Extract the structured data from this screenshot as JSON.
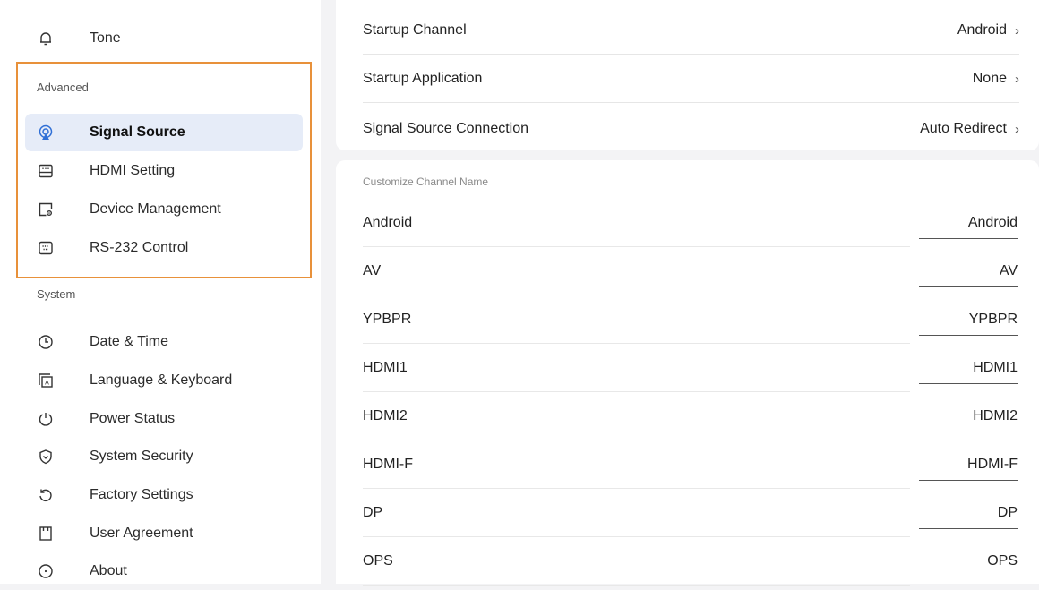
{
  "sidebar": {
    "top_item": {
      "label": "Tone",
      "icon": "bell-icon"
    },
    "advanced_label": "Advanced",
    "advanced_items": [
      {
        "label": "Signal Source",
        "icon": "signal-source-icon",
        "active": true
      },
      {
        "label": "HDMI Setting",
        "icon": "hdmi-icon"
      },
      {
        "label": "Device Management",
        "icon": "device-management-icon"
      },
      {
        "label": "RS-232 Control",
        "icon": "rs232-icon"
      }
    ],
    "system_label": "System",
    "system_items": [
      {
        "label": "Date & Time",
        "icon": "clock-icon"
      },
      {
        "label": "Language & Keyboard",
        "icon": "language-icon"
      },
      {
        "label": "Power Status",
        "icon": "power-icon"
      },
      {
        "label": "System Security",
        "icon": "shield-icon"
      },
      {
        "label": "Factory Settings",
        "icon": "reset-icon"
      },
      {
        "label": "User Agreement",
        "icon": "bookmark-icon"
      },
      {
        "label": "About",
        "icon": "info-icon"
      }
    ]
  },
  "startup": {
    "rows": [
      {
        "label": "Startup Channel",
        "value": "Android"
      },
      {
        "label": "Startup Application",
        "value": "None"
      },
      {
        "label": "Signal Source Connection",
        "value": "Auto Redirect"
      }
    ]
  },
  "customize": {
    "title": "Customize Channel Name",
    "channels": [
      {
        "label": "Android",
        "value": "Android"
      },
      {
        "label": "AV",
        "value": "AV"
      },
      {
        "label": "YPBPR",
        "value": "YPBPR"
      },
      {
        "label": "HDMI1",
        "value": "HDMI1"
      },
      {
        "label": "HDMI2",
        "value": "HDMI2"
      },
      {
        "label": "HDMI-F",
        "value": "HDMI-F"
      },
      {
        "label": "DP",
        "value": "DP"
      },
      {
        "label": "OPS",
        "value": "OPS"
      }
    ]
  },
  "colors": {
    "highlight_border": "#e8913a",
    "active_bg": "#e6ecf8",
    "accent": "#2f6fd6"
  }
}
